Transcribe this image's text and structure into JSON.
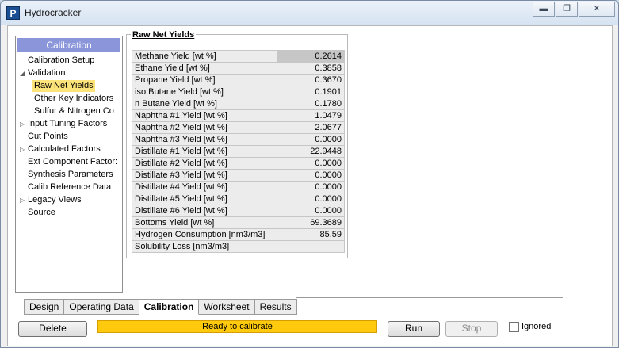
{
  "window": {
    "title": "Hydrocracker",
    "app_icon": "P",
    "controls": [
      "minimize",
      "restore",
      "close"
    ]
  },
  "nav": {
    "header": "Calibration",
    "items": [
      {
        "label": "Calibration Setup",
        "level": 0,
        "expandable": false
      },
      {
        "label": "Validation",
        "level": 0,
        "expandable": true,
        "expanded": true
      },
      {
        "label": "Raw Net Yields",
        "level": 1,
        "selected": true
      },
      {
        "label": "Other Key Indicators",
        "level": 1
      },
      {
        "label": "Sulfur & Nitrogen Co",
        "level": 1
      },
      {
        "label": "Input Tuning Factors",
        "level": 0,
        "expandable": true
      },
      {
        "label": "Cut Points",
        "level": 0
      },
      {
        "label": "Calculated Factors",
        "level": 0,
        "expandable": true
      },
      {
        "label": "Ext Component Factor:",
        "level": 0
      },
      {
        "label": "Synthesis Parameters",
        "level": 0
      },
      {
        "label": "Calib Reference Data",
        "level": 0
      },
      {
        "label": "Legacy Views",
        "level": 0,
        "expandable": true
      },
      {
        "label": "Source",
        "level": 0
      }
    ]
  },
  "yields": {
    "title": "Raw Net Yields",
    "rows": [
      {
        "label": "Methane Yield [wt %]",
        "value": "0.2614"
      },
      {
        "label": "Ethane Yield [wt %]",
        "value": "0.3858"
      },
      {
        "label": "Propane Yield [wt %]",
        "value": "0.3670"
      },
      {
        "label": "iso Butane Yield [wt %]",
        "value": "0.1901"
      },
      {
        "label": "n Butane Yield [wt %]",
        "value": "0.1780"
      },
      {
        "label": "Naphtha #1 Yield [wt %]",
        "value": "1.0479"
      },
      {
        "label": "Naphtha #2 Yield [wt %]",
        "value": "2.0677"
      },
      {
        "label": "Naphtha #3 Yield [wt %]",
        "value": "0.0000"
      },
      {
        "label": "Distillate #1 Yield [wt %]",
        "value": "22.9448"
      },
      {
        "label": "Distillate #2 Yield [wt %]",
        "value": "0.0000"
      },
      {
        "label": "Distillate #3 Yield [wt %]",
        "value": "0.0000"
      },
      {
        "label": "Distillate #4 Yield [wt %]",
        "value": "0.0000"
      },
      {
        "label": "Distillate #5 Yield [wt %]",
        "value": "0.0000"
      },
      {
        "label": "Distillate #6 Yield [wt %]",
        "value": "0.0000"
      },
      {
        "label": "Bottoms Yield [wt %]",
        "value": "69.3689"
      },
      {
        "label": "Hydrogen Consumption [nm3/m3]",
        "value": "85.59"
      },
      {
        "label": "Solubility Loss [nm3/m3]",
        "value": ""
      }
    ]
  },
  "tabs": [
    "Design",
    "Operating Data",
    "Calibration",
    "Worksheet",
    "Results"
  ],
  "active_tab": "Calibration",
  "footer": {
    "delete_label": "Delete",
    "status_text": "Ready to calibrate",
    "status_color": "#ffc90e",
    "run_label": "Run",
    "stop_label": "Stop",
    "ignored_label": "Ignored",
    "ignored_checked": false
  }
}
